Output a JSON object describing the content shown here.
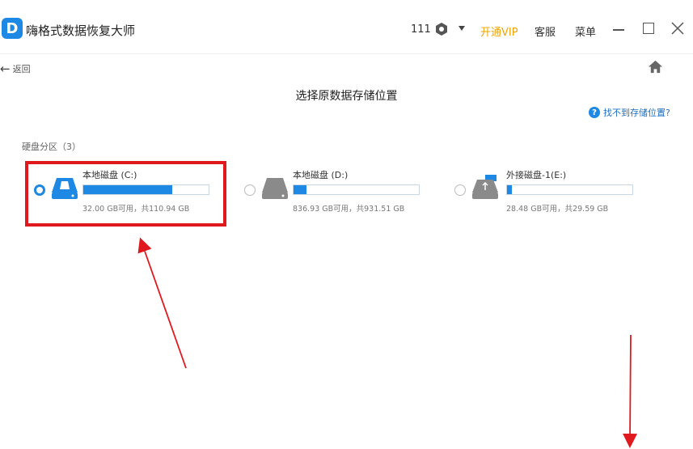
{
  "app": {
    "logo_letter": "D",
    "title": "嗨格式数据恢复大师"
  },
  "header": {
    "user_count": "111",
    "vip_label": "开通VIP",
    "support_label": "客服",
    "menu_label": "菜单"
  },
  "nav": {
    "back_label": "返回"
  },
  "page": {
    "title": "选择原数据存储位置",
    "help_label": "找不到存储位置?",
    "section_label": "硬盘分区（3）"
  },
  "drives": [
    {
      "name": "本地磁盘 (C:)",
      "size_text": "32.00 GB可用，共110.94 GB",
      "used_fraction": 0.712,
      "selected": true,
      "icon": "hard-drive-icon"
    },
    {
      "name": "本地磁盘 (D:)",
      "size_text": "836.93 GB可用，共931.51 GB",
      "used_fraction": 0.102,
      "selected": false,
      "icon": "hard-drive-icon"
    },
    {
      "name": "外接磁盘-1(E:)",
      "size_text": "28.48 GB可用，共29.59 GB",
      "used_fraction": 0.038,
      "selected": false,
      "icon": "usb-drive-icon"
    }
  ],
  "colors": {
    "accent": "#1e88e5",
    "vip": "#f0a500",
    "annotation": "#e0191f"
  }
}
